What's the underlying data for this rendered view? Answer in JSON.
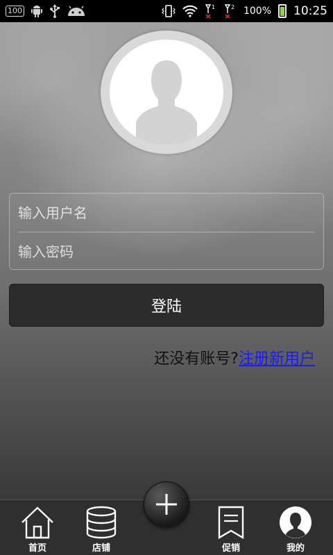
{
  "status_bar": {
    "notification_badge": "100",
    "battery_percent": "100%",
    "time": "10:25",
    "sim1_label": "1",
    "sim2_label": "2"
  },
  "login": {
    "username_placeholder": "输入用户名",
    "password_placeholder": "输入密码",
    "login_button_label": "登陆",
    "register_prompt": "还没有账号?",
    "register_link": "注册新用户"
  },
  "bottom_nav": {
    "items": [
      {
        "label": "首页",
        "icon": "home-icon"
      },
      {
        "label": "店铺",
        "icon": "database-icon"
      },
      {
        "label": "促销",
        "icon": "bookmark-icon"
      },
      {
        "label": "我的",
        "icon": "user-icon"
      }
    ],
    "center_button_icon": "plus-icon"
  },
  "colors": {
    "status_bar_bg": "#000000",
    "login_button_bg": "#2c2c2c",
    "link_color": "#1a1aff",
    "nav_bg": "#2f2f2f"
  }
}
